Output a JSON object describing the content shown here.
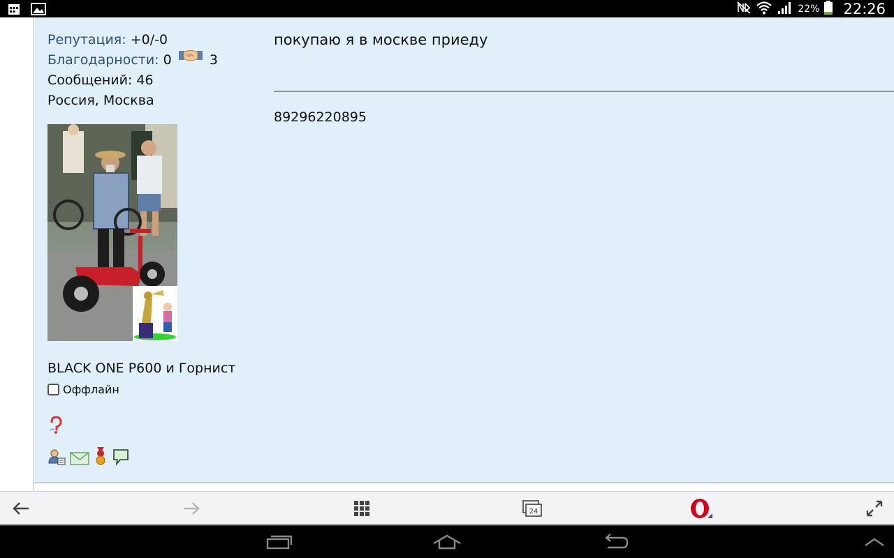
{
  "status_bar": {
    "time": "22:26",
    "battery_percent": "22%",
    "battery_level": 0.22,
    "icons": [
      "notification-calendar-icon",
      "gallery-icon",
      "mute-icon",
      "wifi-icon",
      "signal-icon",
      "battery-icon"
    ]
  },
  "profile": {
    "reputation_label": "Репутация:",
    "reputation_value": "+0/-0",
    "thanks_label": "Благодарности:",
    "thanks_given": "0",
    "thanks_received": "3",
    "messages_label": "Сообщений:",
    "messages_value": "46",
    "location": "Россия, Москва",
    "user_title": "BLACK ONE P600 и Горнист",
    "online_status": "Оффлайн"
  },
  "message": {
    "title": "покупаю я в москве приеду",
    "body": "89296220895"
  },
  "browser_toolbar": {
    "tabs_count": "24",
    "items": [
      "back-icon",
      "forward-icon",
      "speed-dial-icon",
      "tabs-icon",
      "opera-menu-icon",
      "fullscreen-icon"
    ]
  },
  "nav_bar": {
    "items": [
      "recent-apps-icon",
      "home-icon",
      "back-nav-icon",
      "nav-expand-icon"
    ]
  },
  "colors": {
    "post_background": "#e1eff8",
    "label_blue": "#2c4f7a",
    "opera_red": "#d3001b"
  }
}
